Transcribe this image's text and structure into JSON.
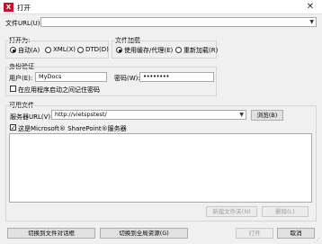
{
  "window": {
    "title": "打开",
    "icon_text": "X",
    "close_label": "✕"
  },
  "file_url": {
    "label": "文件URL(U):",
    "value": ""
  },
  "open_as": {
    "heading": "打开为:",
    "options": [
      {
        "label": "自动(A)",
        "selected": true
      },
      {
        "label": "XML(X)",
        "selected": false
      },
      {
        "label": "DTD(D)",
        "selected": false
      }
    ]
  },
  "file_load": {
    "heading": "文件加载",
    "options": [
      {
        "label": "使用缓存/代理(E)",
        "selected": true
      },
      {
        "label": "重新加载(R)",
        "selected": false
      }
    ]
  },
  "auth": {
    "heading": "身份验证",
    "user_label": "用户(E):",
    "user_value": "MyDocs",
    "password_label": "密码(W):",
    "password_value": "••••••••",
    "remember_label": "在应用程序启动之间记住密码",
    "remember_checked": false
  },
  "available_files": {
    "heading": "可用文件",
    "server_url_label": "服务器URL(V):",
    "server_url_value": "http://vietspstest/",
    "browse_label": "浏览(B)",
    "sharepoint_label": "这是Microsoft® SharePoint®服务器",
    "sharepoint_checked": true,
    "new_folder_label": "新建文件夹(N)",
    "delete_label": "删除(L)"
  },
  "footer": {
    "switch_file_dialog": "切换到文件对话框",
    "switch_global_resources": "切换到全局资源(G)",
    "open_label": "打开",
    "cancel_label": "取消"
  }
}
